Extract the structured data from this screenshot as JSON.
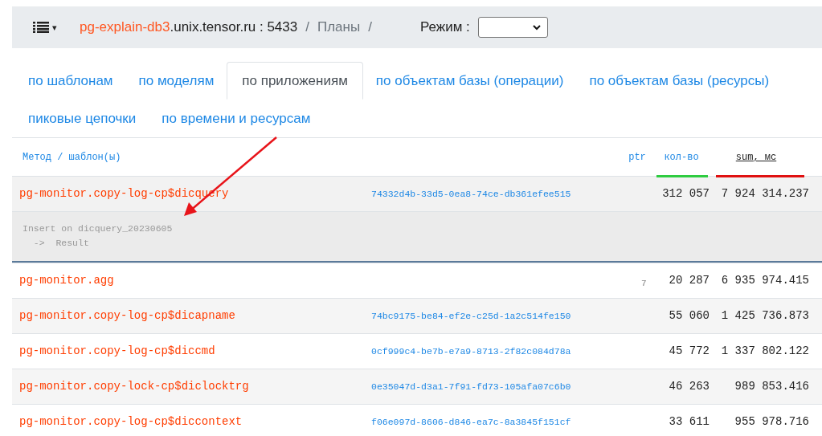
{
  "header": {
    "menu_caret": "▾",
    "host_highlight": "pg-explain-db3",
    "host_rest": ".unix.tensor.ru : 5433",
    "separator_1": "/",
    "breadcrumb": "Планы",
    "separator_2": "/",
    "mode_label": "Режим :"
  },
  "tabs": [
    {
      "label": "по шаблонам",
      "selected": false
    },
    {
      "label": "по моделям",
      "selected": false
    },
    {
      "label": "по приложениям",
      "selected": true
    },
    {
      "label": "по объектам базы (операции)",
      "selected": false
    },
    {
      "label": "по объектам базы (ресурсы)",
      "selected": false
    },
    {
      "label": "пиковые цепочки",
      "selected": false
    },
    {
      "label": "по времени и ресурсам",
      "selected": false
    }
  ],
  "table": {
    "columns": [
      {
        "label": "Метод / шаблон(ы)",
        "sorted": false
      },
      {
        "label": "ptr",
        "sorted": false
      },
      {
        "label": "кол-во",
        "sorted": false
      },
      {
        "label": "sum, мс",
        "sorted": true
      }
    ],
    "rows": [
      {
        "method": "pg-monitor.copy-log-cp$dicquery",
        "id": "74332d4b-33d5-0ea8-74ce-db361efee515",
        "count": "312 057",
        "sum": "7 924 314.237",
        "expanded": true,
        "plan": [
          "Insert on dicquery_20230605",
          "  ->  Result"
        ]
      },
      {
        "method": "pg-monitor.agg",
        "ptr": "7",
        "count": "20 287",
        "sum": "6 935 974.415",
        "expanded": false
      },
      {
        "method": "pg-monitor.copy-log-cp$dicapname",
        "id": "74bc9175-be84-ef2e-c25d-1a2c514fe150",
        "count": "55 060",
        "sum": "1 425 736.873",
        "expanded": false
      },
      {
        "method": "pg-monitor.copy-log-cp$diccmd",
        "id": "0cf999c4-be7b-e7a9-8713-2f82c084d78a",
        "count": "45 772",
        "sum": "1 337 802.122",
        "expanded": false
      },
      {
        "method": "pg-monitor.copy-lock-cp$diclocktrg",
        "id": "0e35047d-d3a1-7f91-fd73-105afa07c6b0",
        "count": "46 263",
        "sum": "989 853.416",
        "expanded": false
      },
      {
        "method": "pg-monitor.copy-log-cp$diccontext",
        "id": "f06e097d-8606-d846-ea7c-8a3845f151cf",
        "count": "33 611",
        "sum": "955 978.716",
        "expanded": false
      }
    ]
  }
}
